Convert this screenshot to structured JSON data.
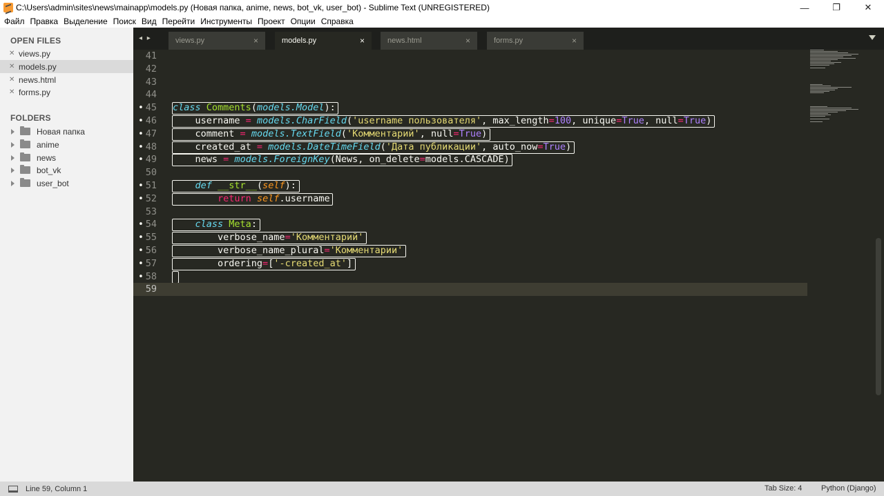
{
  "window": {
    "title": "C:\\Users\\admin\\sites\\news\\mainapp\\models.py (Новая папка, anime, news, bot_vk, user_bot) - Sublime Text (UNREGISTERED)",
    "minimize": "—",
    "maximize": "❐",
    "close": "✕"
  },
  "menu": [
    "Файл",
    "Правка",
    "Выделение",
    "Поиск",
    "Вид",
    "Перейти",
    "Инструменты",
    "Проект",
    "Опции",
    "Справка"
  ],
  "sidebar": {
    "open_files_heading": "OPEN FILES",
    "open_files": [
      {
        "name": "views.py",
        "active": false
      },
      {
        "name": "models.py",
        "active": true
      },
      {
        "name": "news.html",
        "active": false
      },
      {
        "name": "forms.py",
        "active": false
      }
    ],
    "folders_heading": "FOLDERS",
    "folders": [
      "Новая папка",
      "anime",
      "news",
      "bot_vk",
      "user_bot"
    ]
  },
  "tabs": {
    "nav": "◂ ▸",
    "items": [
      {
        "label": "views.py",
        "active": false
      },
      {
        "label": "models.py",
        "active": true
      },
      {
        "label": "news.html",
        "active": false
      },
      {
        "label": "forms.py",
        "active": false
      }
    ],
    "close_glyph": "×"
  },
  "editor": {
    "current_line": 59,
    "lines": [
      {
        "n": "41",
        "dot": false,
        "tokens": []
      },
      {
        "n": "42",
        "dot": false,
        "tokens": []
      },
      {
        "n": "43",
        "dot": false,
        "tokens": []
      },
      {
        "n": "44",
        "dot": false,
        "tokens": []
      },
      {
        "n": "45",
        "dot": true,
        "tokens": [
          [
            "kw-i",
            "class"
          ],
          [
            "pl",
            " "
          ],
          [
            "cls",
            "Comments"
          ],
          [
            "pl",
            "("
          ],
          [
            "fn-i",
            "models.Model"
          ],
          [
            "pl",
            "):"
          ]
        ]
      },
      {
        "n": "46",
        "dot": true,
        "tokens": [
          [
            "pl",
            "    username "
          ],
          [
            "op",
            "="
          ],
          [
            "pl",
            " "
          ],
          [
            "fn-i",
            "models.CharField"
          ],
          [
            "pl",
            "("
          ],
          [
            "str",
            "'username пользователя'"
          ],
          [
            "pl",
            ", max_length"
          ],
          [
            "op",
            "="
          ],
          [
            "num",
            "100"
          ],
          [
            "pl",
            ", unique"
          ],
          [
            "op",
            "="
          ],
          [
            "num",
            "True"
          ],
          [
            "pl",
            ", null"
          ],
          [
            "op",
            "="
          ],
          [
            "num",
            "True"
          ],
          [
            "pl",
            ")"
          ]
        ]
      },
      {
        "n": "47",
        "dot": true,
        "tokens": [
          [
            "pl",
            "    comment "
          ],
          [
            "op",
            "="
          ],
          [
            "pl",
            " "
          ],
          [
            "fn-i",
            "models.TextField"
          ],
          [
            "pl",
            "("
          ],
          [
            "str",
            "'Комментарий'"
          ],
          [
            "pl",
            ", null"
          ],
          [
            "op",
            "="
          ],
          [
            "num",
            "True"
          ],
          [
            "pl",
            ")"
          ]
        ]
      },
      {
        "n": "48",
        "dot": true,
        "tokens": [
          [
            "pl",
            "    created_at "
          ],
          [
            "op",
            "="
          ],
          [
            "pl",
            " "
          ],
          [
            "fn-i",
            "models.DateTimeField"
          ],
          [
            "pl",
            "("
          ],
          [
            "str",
            "'Дата публикации'"
          ],
          [
            "pl",
            ", auto_now"
          ],
          [
            "op",
            "="
          ],
          [
            "num",
            "True"
          ],
          [
            "pl",
            ")"
          ]
        ]
      },
      {
        "n": "49",
        "dot": true,
        "tokens": [
          [
            "pl",
            "    news "
          ],
          [
            "op",
            "="
          ],
          [
            "pl",
            " "
          ],
          [
            "fn-i",
            "models.ForeignKey"
          ],
          [
            "pl",
            "(News, on_delete"
          ],
          [
            "op",
            "="
          ],
          [
            "pl",
            "models.CASCADE)"
          ]
        ]
      },
      {
        "n": "50",
        "dot": false,
        "tokens": []
      },
      {
        "n": "51",
        "dot": true,
        "tokens": [
          [
            "pl",
            "    "
          ],
          [
            "kw-i",
            "def"
          ],
          [
            "pl",
            " "
          ],
          [
            "cls",
            "__str__"
          ],
          [
            "pl",
            "("
          ],
          [
            "self",
            "self"
          ],
          [
            "pl",
            "):"
          ]
        ]
      },
      {
        "n": "52",
        "dot": true,
        "tokens": [
          [
            "pl",
            "        "
          ],
          [
            "op",
            "return"
          ],
          [
            "pl",
            " "
          ],
          [
            "self",
            "self"
          ],
          [
            "pl",
            ".username"
          ]
        ]
      },
      {
        "n": "53",
        "dot": false,
        "tokens": []
      },
      {
        "n": "54",
        "dot": true,
        "tokens": [
          [
            "pl",
            "    "
          ],
          [
            "kw-i",
            "class"
          ],
          [
            "pl",
            " "
          ],
          [
            "cls",
            "Meta"
          ],
          [
            "pl",
            ":"
          ]
        ]
      },
      {
        "n": "55",
        "dot": true,
        "tokens": [
          [
            "pl",
            "        verbose_name"
          ],
          [
            "op",
            "="
          ],
          [
            "str",
            "'Комментарий'"
          ]
        ]
      },
      {
        "n": "56",
        "dot": true,
        "tokens": [
          [
            "pl",
            "        verbose_name_plural"
          ],
          [
            "op",
            "="
          ],
          [
            "str",
            "'Комментарии'"
          ]
        ]
      },
      {
        "n": "57",
        "dot": true,
        "tokens": [
          [
            "pl",
            "        ordering"
          ],
          [
            "op",
            "="
          ],
          [
            "pl",
            "["
          ],
          [
            "str",
            "'-created_at'"
          ],
          [
            "pl",
            "]"
          ]
        ]
      },
      {
        "n": "58",
        "dot": true,
        "tokens": []
      },
      {
        "n": "59",
        "dot": false,
        "tokens": []
      }
    ]
  },
  "statusbar": {
    "position": "Line 59, Column 1",
    "tab_size": "Tab Size: 4",
    "syntax": "Python (Django)"
  },
  "colors": {
    "editor_bg": "#272822",
    "keyword": "#66d9ef",
    "class_name": "#a6e22e",
    "operator": "#f92672",
    "string": "#e6db74",
    "number": "#ae81ff",
    "self": "#fd971f"
  }
}
